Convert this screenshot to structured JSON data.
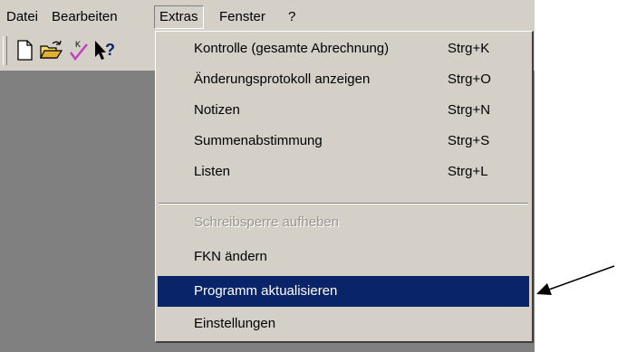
{
  "menubar": {
    "items": [
      {
        "label": "Datei"
      },
      {
        "label": "Bearbeiten"
      },
      {
        "label": "Extras"
      },
      {
        "label": "Fenster"
      },
      {
        "label": "?"
      }
    ]
  },
  "toolbar": {
    "icons": [
      "new-document-icon",
      "open-folder-icon",
      "check-icon",
      "context-help-icon"
    ]
  },
  "extras_menu": {
    "items": [
      {
        "label": "Kontrolle (gesamte Abrechnung)",
        "shortcut": "Strg+K",
        "enabled": true
      },
      {
        "label": "Änderungsprotokoll anzeigen",
        "shortcut": "Strg+O",
        "enabled": true
      },
      {
        "label": "Notizen",
        "shortcut": "Strg+N",
        "enabled": true
      },
      {
        "label": "Summenabstimmung",
        "shortcut": "Strg+S",
        "enabled": true
      },
      {
        "label": "Listen",
        "shortcut": "Strg+L",
        "enabled": true
      },
      {
        "label": "Schreibsperre aufheben",
        "shortcut": "",
        "enabled": false
      },
      {
        "label": "FKN ändern",
        "shortcut": "",
        "enabled": true
      },
      {
        "label": "Programm aktualisieren",
        "shortcut": "",
        "enabled": true,
        "selected": true
      },
      {
        "label": "Einstellungen",
        "shortcut": "",
        "enabled": true
      }
    ]
  },
  "colors": {
    "chrome": "#d4d0c8",
    "workspace": "#808080",
    "selection": "#0a246a",
    "disabled_text": "#9a968e"
  }
}
